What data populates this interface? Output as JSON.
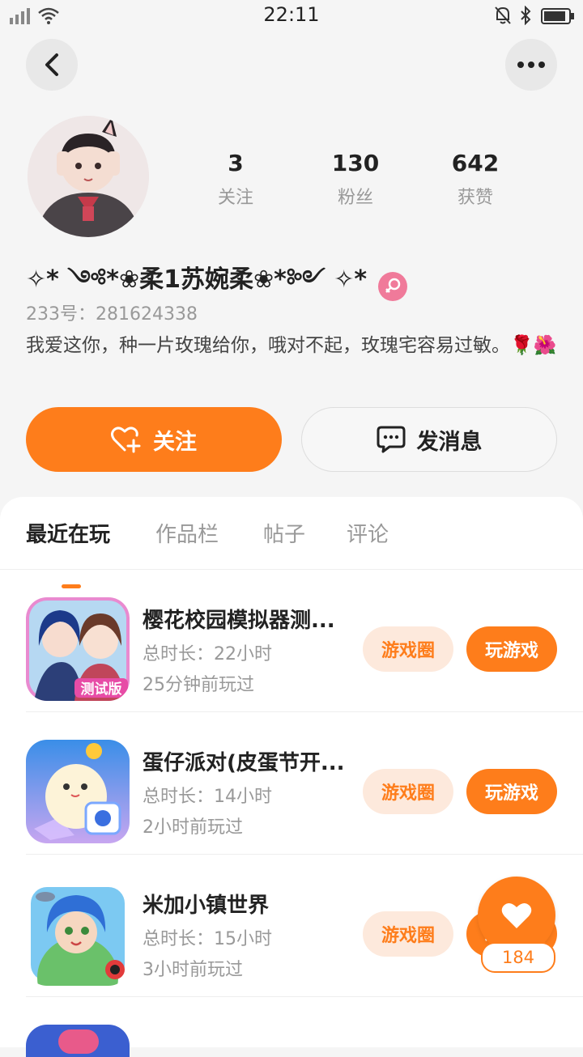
{
  "status_bar": {
    "time": "22:11"
  },
  "profile": {
    "stats": [
      {
        "value": "3",
        "label": "关注"
      },
      {
        "value": "130",
        "label": "粉丝"
      },
      {
        "value": "642",
        "label": "获赞"
      }
    ],
    "nickname": "✧* ༺*❀柔1苏婉柔❀*༻ ✧*",
    "gender": "female",
    "id_line": "233号：281624338",
    "bio": "我爱这你，种一片玫瑰给你，哦对不起，玫瑰宅容易过敏。🌹🌺"
  },
  "actions": {
    "follow": "关注",
    "message": "发消息"
  },
  "tabs": [
    {
      "label": "最近在玩",
      "active": true
    },
    {
      "label": "作品栏",
      "active": false
    },
    {
      "label": "帖子",
      "active": false
    },
    {
      "label": "评论",
      "active": false
    }
  ],
  "games": [
    {
      "title": "樱花校园模拟器测...",
      "duration": "总时长：22小时",
      "last_played": "25分钟前玩过",
      "circle_label": "游戏圈",
      "play_label": "玩游戏",
      "icon_badge": "测试版"
    },
    {
      "title": "蛋仔派对(皮蛋节开...",
      "duration": "总时长：14小时",
      "last_played": "2小时前玩过",
      "circle_label": "游戏圈",
      "play_label": "玩游戏",
      "icon_badge": ""
    },
    {
      "title": "米加小镇世界",
      "duration": "总时长：15小时",
      "last_played": "3小时前玩过",
      "circle_label": "游戏圈",
      "play_label": "玩游戏",
      "icon_badge": ""
    }
  ],
  "like_fab": {
    "count": "184"
  },
  "colors": {
    "accent": "#fe7d1b",
    "accent_light": "#fde9dc",
    "gender_badge": "#f07a9a"
  }
}
